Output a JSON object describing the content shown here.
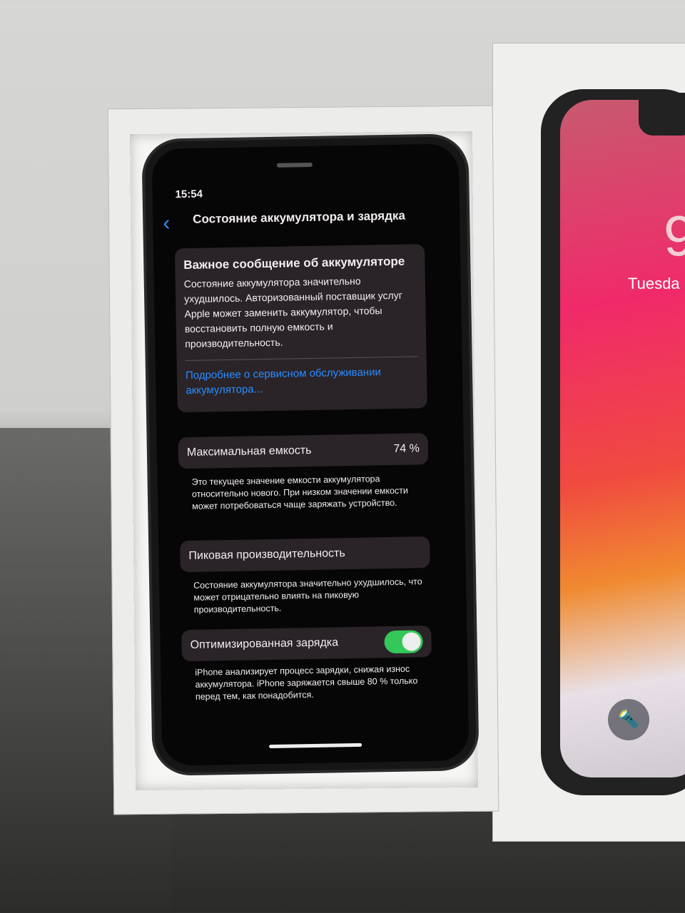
{
  "status_bar": {
    "time": "15:54"
  },
  "nav": {
    "title": "Состояние аккумулятора и зарядка"
  },
  "alert": {
    "title": "Важное сообщение об аккумуляторе",
    "body": "Состояние аккумулятора значительно ухудшилось. Авторизованный поставщик услуг Apple может заменить аккумулятор, чтобы восстановить полную емкость и производительность.",
    "link": "Подробнее о сервисном обслуживании аккумулятора..."
  },
  "capacity": {
    "label": "Максимальная емкость",
    "value": "74 %",
    "note": "Это текущее значение емкости аккумулятора относительно нового. При низком значении емкости может потребоваться чаще заряжать устройство."
  },
  "peak": {
    "label": "Пиковая производительность",
    "note": "Состояние аккумулятора значительно ухудшилось, что может отрицательно влиять на пиковую производительность."
  },
  "optimized": {
    "label": "Оптимизированная зарядка",
    "enabled": true,
    "note": "iPhone анализирует процесс зарядки, снижая износ аккумулятора. iPhone заряжается свыше 80 % только перед тем, как понадобится."
  },
  "box": {
    "clock_digit": "9",
    "day": "Tuesda"
  }
}
